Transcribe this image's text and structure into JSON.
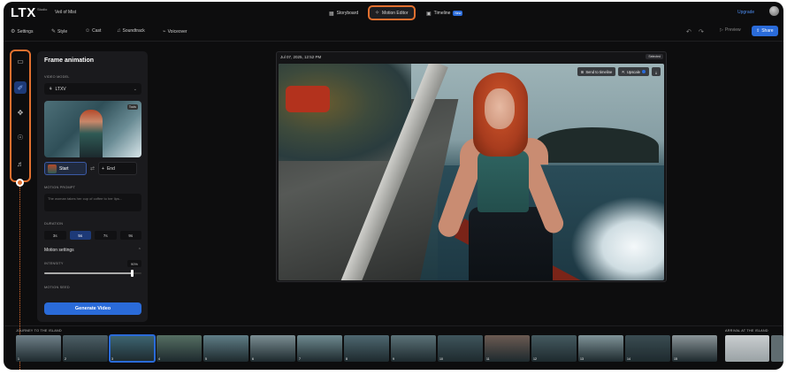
{
  "app": {
    "logo": "LTX",
    "logo_sub": "Studio",
    "project": "Veil of Mist"
  },
  "nav": {
    "storyboard": "Storyboard",
    "motion_editor": "Motion Editor",
    "timeline": "Timeline",
    "timeline_badge": "New",
    "upgrade": "Upgrade"
  },
  "toolbar": {
    "settings": "Settings",
    "style": "Style",
    "cast": "Cast",
    "soundtrack": "Soundtrack",
    "voiceover": "Voiceover",
    "preview": "Preview",
    "share": "Share"
  },
  "panel": {
    "title": "Frame animation",
    "video_model_label": "VIDEO MODEL",
    "video_model": "LTXV",
    "thumb_tag": "Tools",
    "start": "Start",
    "end": "End",
    "motion_prompt_label": "MOTION PROMPT",
    "motion_prompt_placeholder": "The woman takes her cup of coffee to her lips...",
    "duration_label": "DURATION",
    "durations": [
      "3s",
      "5s",
      "7s",
      "9s"
    ],
    "duration_selected": "5s",
    "motion_settings": "Motion settings",
    "intensity_label": "INTENSITY",
    "intensity_value": "90%",
    "intensity_fraction": 0.9,
    "motion_seed_label": "MOTION SEED",
    "generate": "Generate Video"
  },
  "canvas": {
    "date": "Jul 07, 2025, 12:52 PM",
    "select_label": "Selected",
    "send_to_timeline": "Send to timeline",
    "upscale": "Upscale"
  },
  "filmstrip": {
    "scene1": "JOURNEY TO THE ISLAND",
    "scene2": "ARRIVAL AT THE ISLAND",
    "shots": [
      {
        "num": "1",
        "color": "#6f8088"
      },
      {
        "num": "2",
        "color": "#4d5f66"
      },
      {
        "num": "3",
        "color": "#3e6673",
        "active": true
      },
      {
        "num": "4",
        "color": "#556e62"
      },
      {
        "num": "5",
        "color": "#5f7d86"
      },
      {
        "num": "6",
        "color": "#7b8e93"
      },
      {
        "num": "7",
        "color": "#6e8a90"
      },
      {
        "num": "8",
        "color": "#4e6770"
      },
      {
        "num": "9",
        "color": "#5b7278"
      },
      {
        "num": "10",
        "color": "#3f555c"
      },
      {
        "num": "11",
        "color": "#6b5a52"
      },
      {
        "num": "12",
        "color": "#455a60"
      },
      {
        "num": "13",
        "color": "#7f9398"
      },
      {
        "num": "14",
        "color": "#3a4c52"
      },
      {
        "num": "15",
        "color": "#8a9498"
      }
    ]
  },
  "colors": {
    "accent": "#2a6bd9",
    "highlight": "#e2702f"
  }
}
